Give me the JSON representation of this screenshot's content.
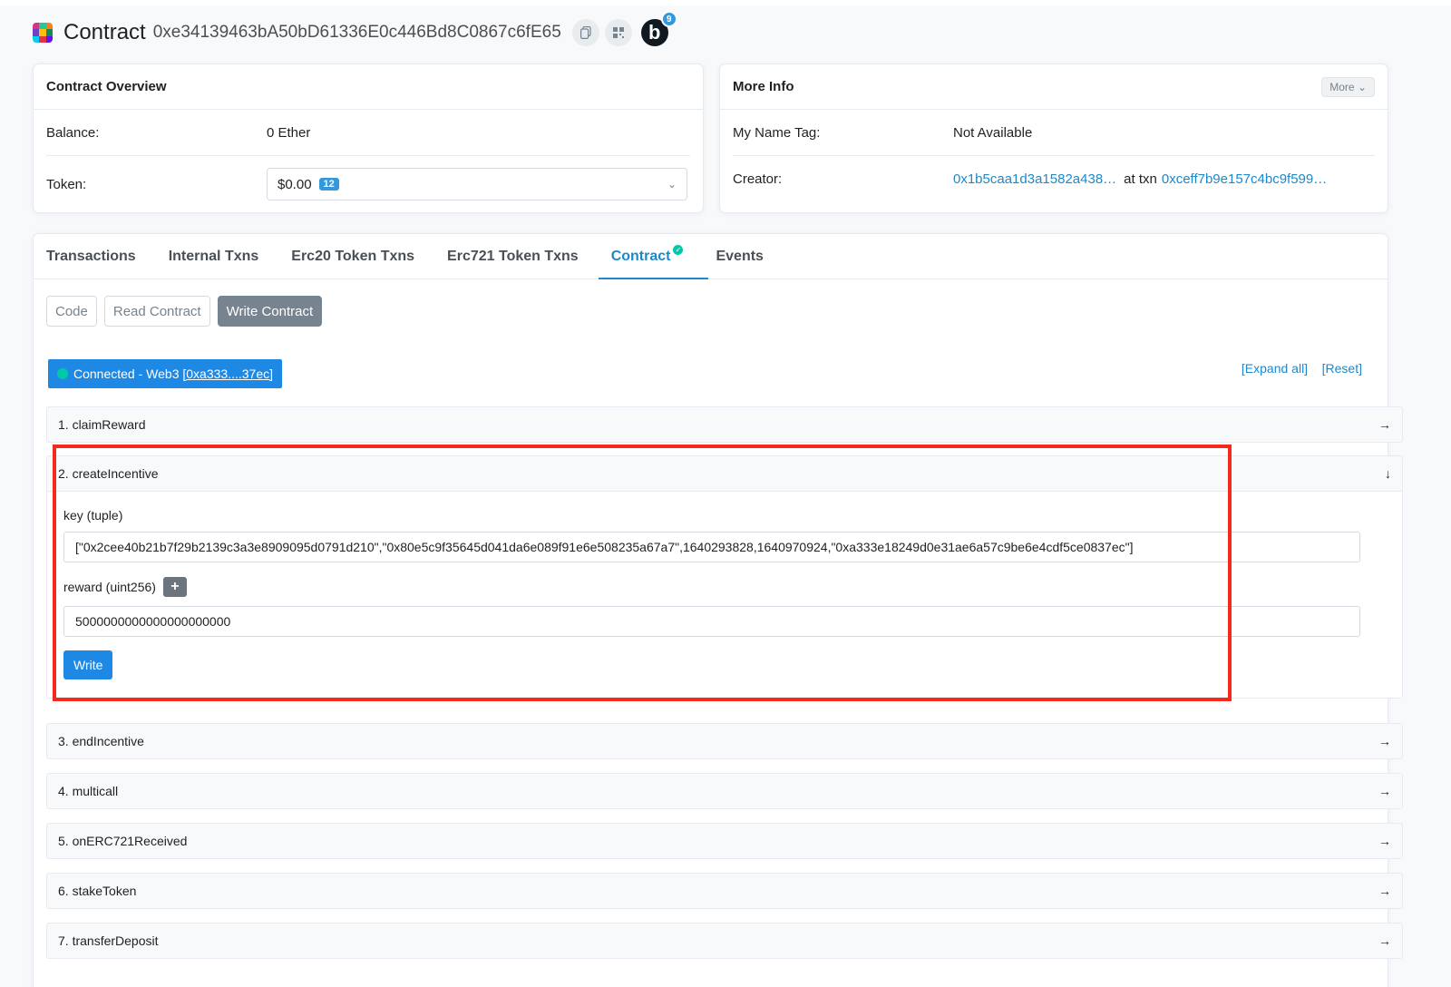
{
  "header": {
    "title": "Contract",
    "address": "0xe34139463bA50bD61336E0c446Bd8C0867c6fE65",
    "copy_icon": "copy-icon",
    "qr_icon": "qr-code-icon",
    "blockscan_letter": "b",
    "blockscan_count": "9"
  },
  "overview": {
    "title": "Contract Overview",
    "balance_label": "Balance:",
    "balance_value": "0 Ether",
    "token_label": "Token:",
    "token_value": "$0.00",
    "token_count": "12"
  },
  "more_info": {
    "title": "More Info",
    "more_button": "More",
    "name_tag_label": "My Name Tag:",
    "name_tag_value": "Not Available",
    "creator_label": "Creator:",
    "creator_address": "0x1b5caa1d3a1582a438…",
    "at_txn": "at txn",
    "creator_txn": "0xceff7b9e157c4bc9f599…"
  },
  "tabs": [
    {
      "label": "Transactions"
    },
    {
      "label": "Internal Txns"
    },
    {
      "label": "Erc20 Token Txns"
    },
    {
      "label": "Erc721 Token Txns"
    },
    {
      "label": "Contract"
    },
    {
      "label": "Events"
    }
  ],
  "subtabs": {
    "code": "Code",
    "read": "Read Contract",
    "write": "Write Contract"
  },
  "connection": {
    "label": "Connected - Web3",
    "account": "[0xa333....37ec]"
  },
  "actions": {
    "expand_all": "[Expand all]",
    "reset": "[Reset]"
  },
  "functions": [
    {
      "label": "1. claimReward"
    },
    {
      "label": "2. createIncentive"
    },
    {
      "label": "3. endIncentive"
    },
    {
      "label": "4. multicall"
    },
    {
      "label": "5. onERC721Received"
    },
    {
      "label": "6. stakeToken"
    },
    {
      "label": "7. transferDeposit"
    }
  ],
  "create_incentive": {
    "key_label": "key (tuple)",
    "key_value": "[\"0x2cee40b21b7f29b2139c3a3e8909095d0791d210\",\"0x80e5c9f35645d041da6e089f91e6e508235a67a7\",1640293828,1640970924,\"0xa333e18249d0e31ae6a57c9be6e4cdf5ce0837ec\"]",
    "reward_label": "reward (uint256)",
    "reward_value": "5000000000000000000000",
    "plus": "+",
    "write_button": "Write"
  },
  "colors": {
    "accent": "#1e88c8",
    "highlight": "#f52a1d",
    "button": "#1e88e5"
  }
}
